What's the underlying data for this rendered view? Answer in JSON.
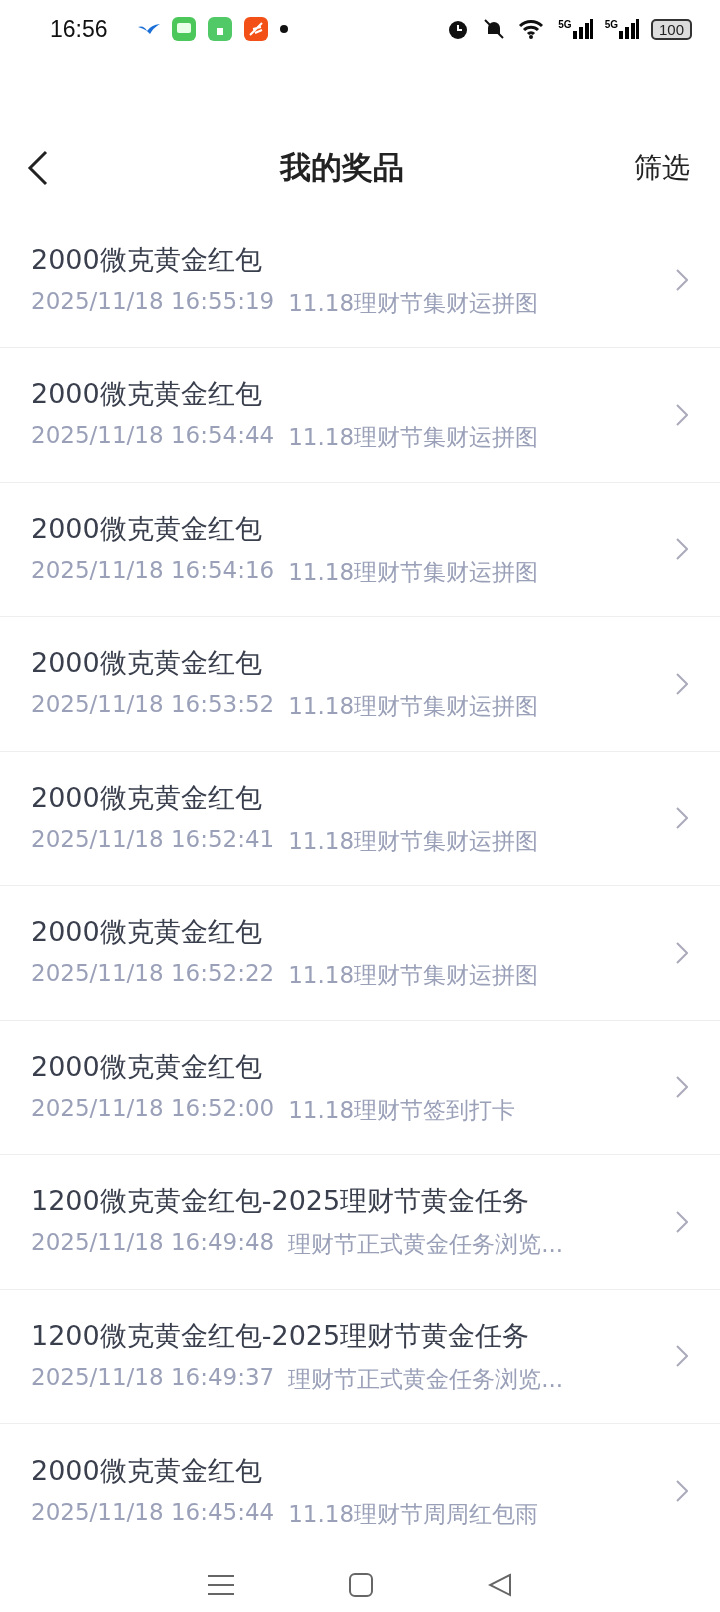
{
  "status_bar": {
    "time": "16:56",
    "battery": "100",
    "network_1": "5G",
    "network_2": "5G"
  },
  "header": {
    "title": "我的奖品",
    "filter": "筛选"
  },
  "prizes": [
    {
      "title": "2000微克黄金红包",
      "time": "2025/11/18 16:55:19",
      "source": "11.18理财节集财运拼图"
    },
    {
      "title": "2000微克黄金红包",
      "time": "2025/11/18 16:54:44",
      "source": "11.18理财节集财运拼图"
    },
    {
      "title": "2000微克黄金红包",
      "time": "2025/11/18 16:54:16",
      "source": "11.18理财节集财运拼图"
    },
    {
      "title": "2000微克黄金红包",
      "time": "2025/11/18 16:53:52",
      "source": "11.18理财节集财运拼图"
    },
    {
      "title": "2000微克黄金红包",
      "time": "2025/11/18 16:52:41",
      "source": "11.18理财节集财运拼图"
    },
    {
      "title": "2000微克黄金红包",
      "time": "2025/11/18 16:52:22",
      "source": "11.18理财节集财运拼图"
    },
    {
      "title": "2000微克黄金红包",
      "time": "2025/11/18 16:52:00",
      "source": "11.18理财节签到打卡"
    },
    {
      "title": "1200微克黄金红包-2025理财节黄金任务",
      "time": "2025/11/18 16:49:48",
      "source": "理财节正式黄金任务浏览..."
    },
    {
      "title": "1200微克黄金红包-2025理财节黄金任务",
      "time": "2025/11/18 16:49:37",
      "source": "理财节正式黄金任务浏览..."
    },
    {
      "title": "2000微克黄金红包",
      "time": "2025/11/18 16:45:44",
      "source": "11.18理财节周周红包雨"
    }
  ]
}
